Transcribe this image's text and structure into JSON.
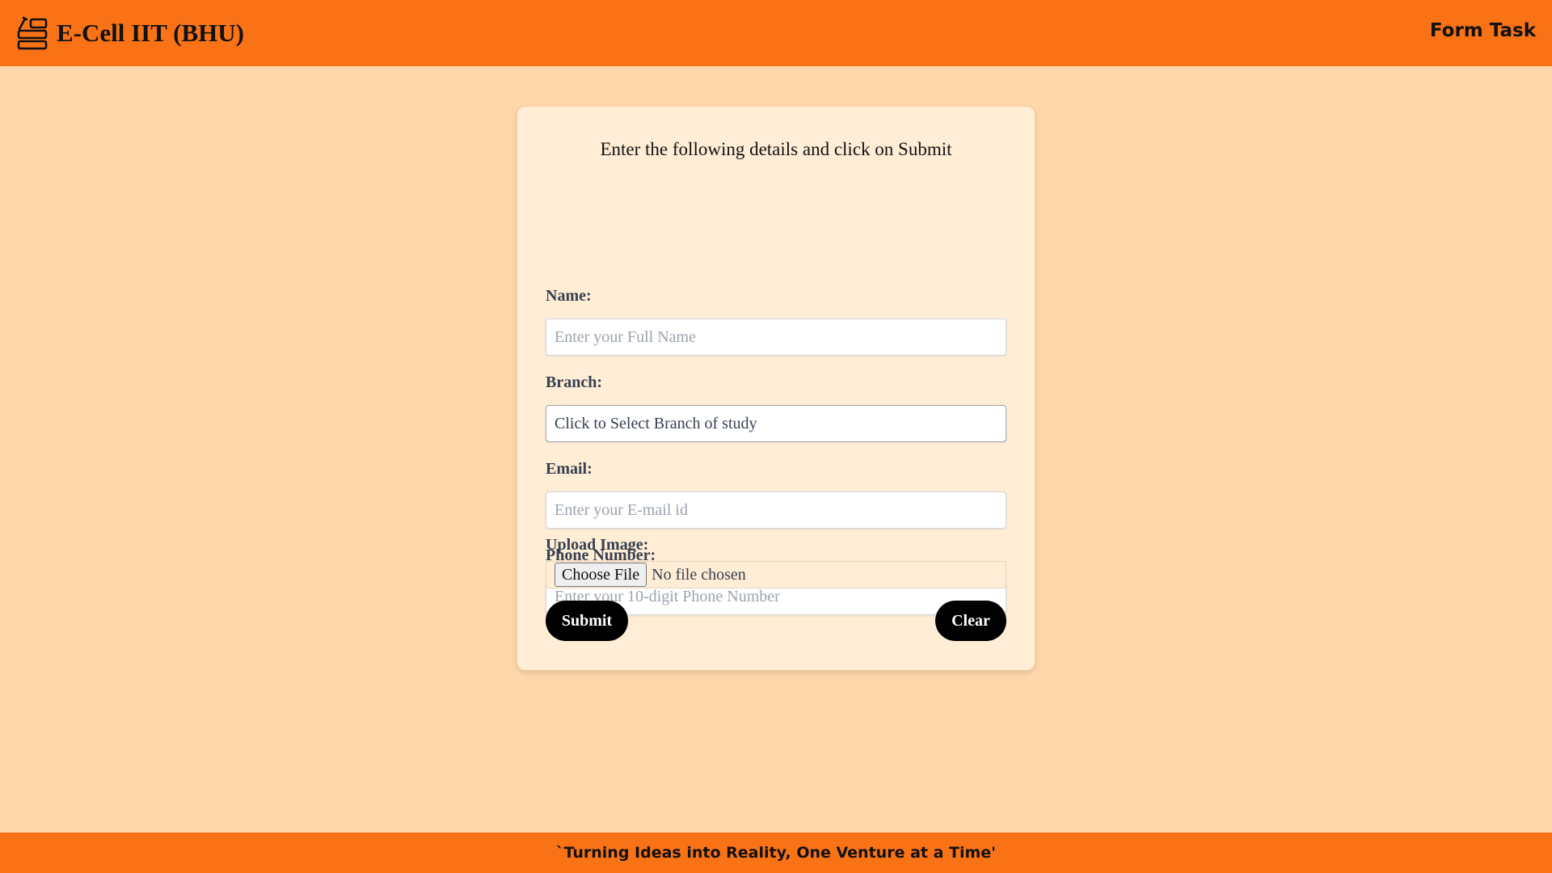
{
  "header": {
    "brand_icon": "form-editor-icon",
    "brand_title": "E-Cell IIT (BHU)",
    "right_text": "Form Task"
  },
  "form": {
    "intro": "Enter the following details and click on Submit",
    "name": {
      "label": "Name:",
      "placeholder": "Enter your Full Name",
      "value": ""
    },
    "branch": {
      "label": "Branch:",
      "selected": "Click to Select Branch of study"
    },
    "email": {
      "label": "Email:",
      "placeholder": "Enter your E-mail id",
      "value": ""
    },
    "phone": {
      "label": "Phone Number:",
      "placeholder": "Enter your 10-digit Phone Number",
      "value": ""
    },
    "upload": {
      "label": "Upload Image:",
      "button_label": "Choose File",
      "status": "No file chosen"
    },
    "submit_label": "Submit",
    "clear_label": "Clear"
  },
  "footer": {
    "tagline": "`Turning Ideas into Reality, One Venture at a Time'"
  },
  "colors": {
    "bar": "#f97316",
    "page_background": "#fed7aa",
    "card_background": "#ffedd5",
    "button": "#000000"
  }
}
